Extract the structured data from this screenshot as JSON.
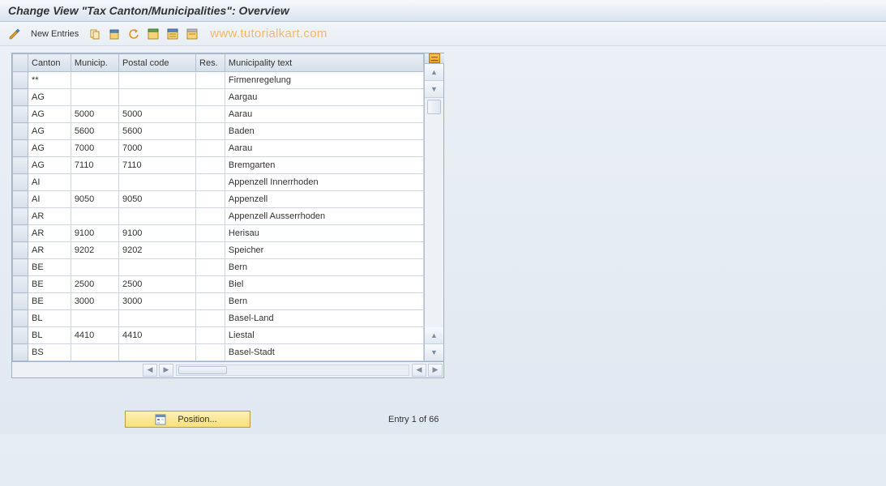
{
  "title": "Change View \"Tax Canton/Municipalities\": Overview",
  "toolbar": {
    "new_entries": "New Entries"
  },
  "watermark": "www.tutorialkart.com",
  "columns": {
    "canton": "Canton",
    "municip": "Municip.",
    "postal": "Postal code",
    "res": "Res.",
    "muntext": "Municipality text"
  },
  "rows": [
    {
      "canton": "**",
      "municip": "",
      "postal": "",
      "res": "",
      "text": "Firmenregelung"
    },
    {
      "canton": "AG",
      "municip": "",
      "postal": "",
      "res": "",
      "text": "Aargau"
    },
    {
      "canton": "AG",
      "municip": "5000",
      "postal": "5000",
      "res": "",
      "text": "Aarau"
    },
    {
      "canton": "AG",
      "municip": "5600",
      "postal": "5600",
      "res": "",
      "text": "Baden"
    },
    {
      "canton": "AG",
      "municip": "7000",
      "postal": "7000",
      "res": "",
      "text": "Aarau"
    },
    {
      "canton": "AG",
      "municip": "7110",
      "postal": "7110",
      "res": "",
      "text": "Bremgarten"
    },
    {
      "canton": "AI",
      "municip": "",
      "postal": "",
      "res": "",
      "text": "Appenzell Innerrhoden"
    },
    {
      "canton": "AI",
      "municip": "9050",
      "postal": "9050",
      "res": "",
      "text": "Appenzell"
    },
    {
      "canton": "AR",
      "municip": "",
      "postal": "",
      "res": "",
      "text": "Appenzell Ausserrhoden"
    },
    {
      "canton": "AR",
      "municip": "9100",
      "postal": "9100",
      "res": "",
      "text": "Herisau"
    },
    {
      "canton": "AR",
      "municip": "9202",
      "postal": "9202",
      "res": "",
      "text": "Speicher"
    },
    {
      "canton": "BE",
      "municip": "",
      "postal": "",
      "res": "",
      "text": "Bern"
    },
    {
      "canton": "BE",
      "municip": "2500",
      "postal": "2500",
      "res": "",
      "text": "Biel"
    },
    {
      "canton": "BE",
      "municip": "3000",
      "postal": "3000",
      "res": "",
      "text": "Bern"
    },
    {
      "canton": "BL",
      "municip": "",
      "postal": "",
      "res": "",
      "text": "Basel-Land"
    },
    {
      "canton": "BL",
      "municip": "4410",
      "postal": "4410",
      "res": "",
      "text": "Liestal"
    },
    {
      "canton": "BS",
      "municip": "",
      "postal": "",
      "res": "",
      "text": "Basel-Stadt"
    }
  ],
  "footer": {
    "position_label": "Position...",
    "entry_text": "Entry 1 of 66"
  }
}
